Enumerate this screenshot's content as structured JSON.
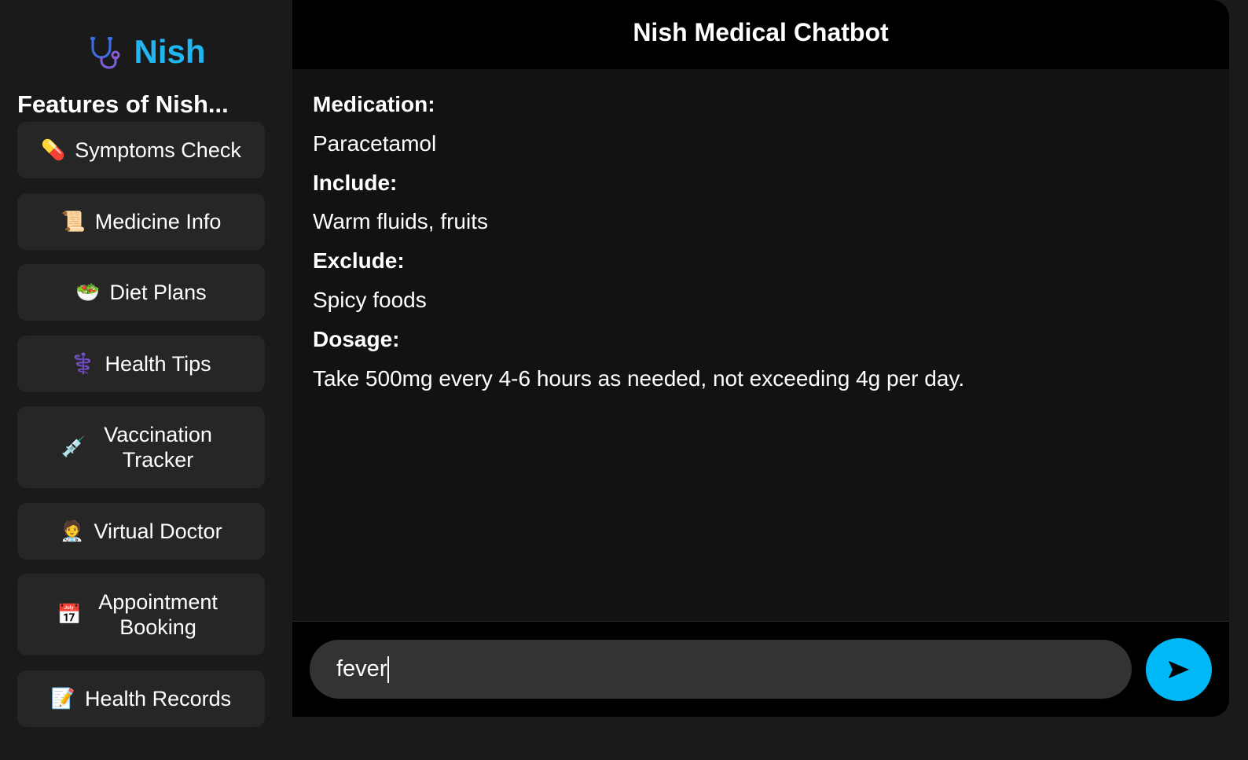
{
  "brand": {
    "name": "Nish",
    "icon": "stethoscope-icon"
  },
  "sidebar": {
    "title": "Features of Nish...",
    "items": [
      {
        "emoji": "💊",
        "icon": "pill-icon",
        "label": "Symptoms Check"
      },
      {
        "emoji": "📜",
        "icon": "scroll-icon",
        "label": "Medicine Info"
      },
      {
        "emoji": "🥗",
        "icon": "salad-icon",
        "label": "Diet Plans"
      },
      {
        "emoji": "⚕️",
        "icon": "medical-symbol-icon",
        "label": "Health Tips"
      },
      {
        "emoji": "💉",
        "icon": "syringe-icon",
        "label": "Vaccination Tracker"
      },
      {
        "emoji": "🧑‍⚕️",
        "icon": "doctor-icon",
        "label": "Virtual Doctor"
      },
      {
        "emoji": "📅",
        "icon": "calendar-icon",
        "label": "Appointment Booking"
      },
      {
        "emoji": "📝",
        "icon": "memo-icon",
        "label": "Health Records"
      }
    ]
  },
  "chat": {
    "title": "Nish Medical Chatbot",
    "messages": [
      {
        "text": "Medication:",
        "bold": true
      },
      {
        "text": "Paracetamol",
        "bold": false
      },
      {
        "text": "Include:",
        "bold": true
      },
      {
        "text": "Warm fluids, fruits",
        "bold": false
      },
      {
        "text": "Exclude:",
        "bold": true
      },
      {
        "text": "Spicy foods",
        "bold": false
      },
      {
        "text": "Dosage:",
        "bold": true
      },
      {
        "text": "Take 500mg every 4-6 hours as needed, not exceeding 4g per day.",
        "bold": false
      }
    ]
  },
  "composer": {
    "input_value": "fever",
    "send_icon": "send-arrow-icon"
  },
  "colors": {
    "accent": "#1fb6f2",
    "send_button": "#00b8f5",
    "sidebar_bg": "#1a1a1a",
    "button_bg": "#262626",
    "chat_bg": "#121212",
    "header_bg": "#000000",
    "input_bg": "#333333"
  }
}
